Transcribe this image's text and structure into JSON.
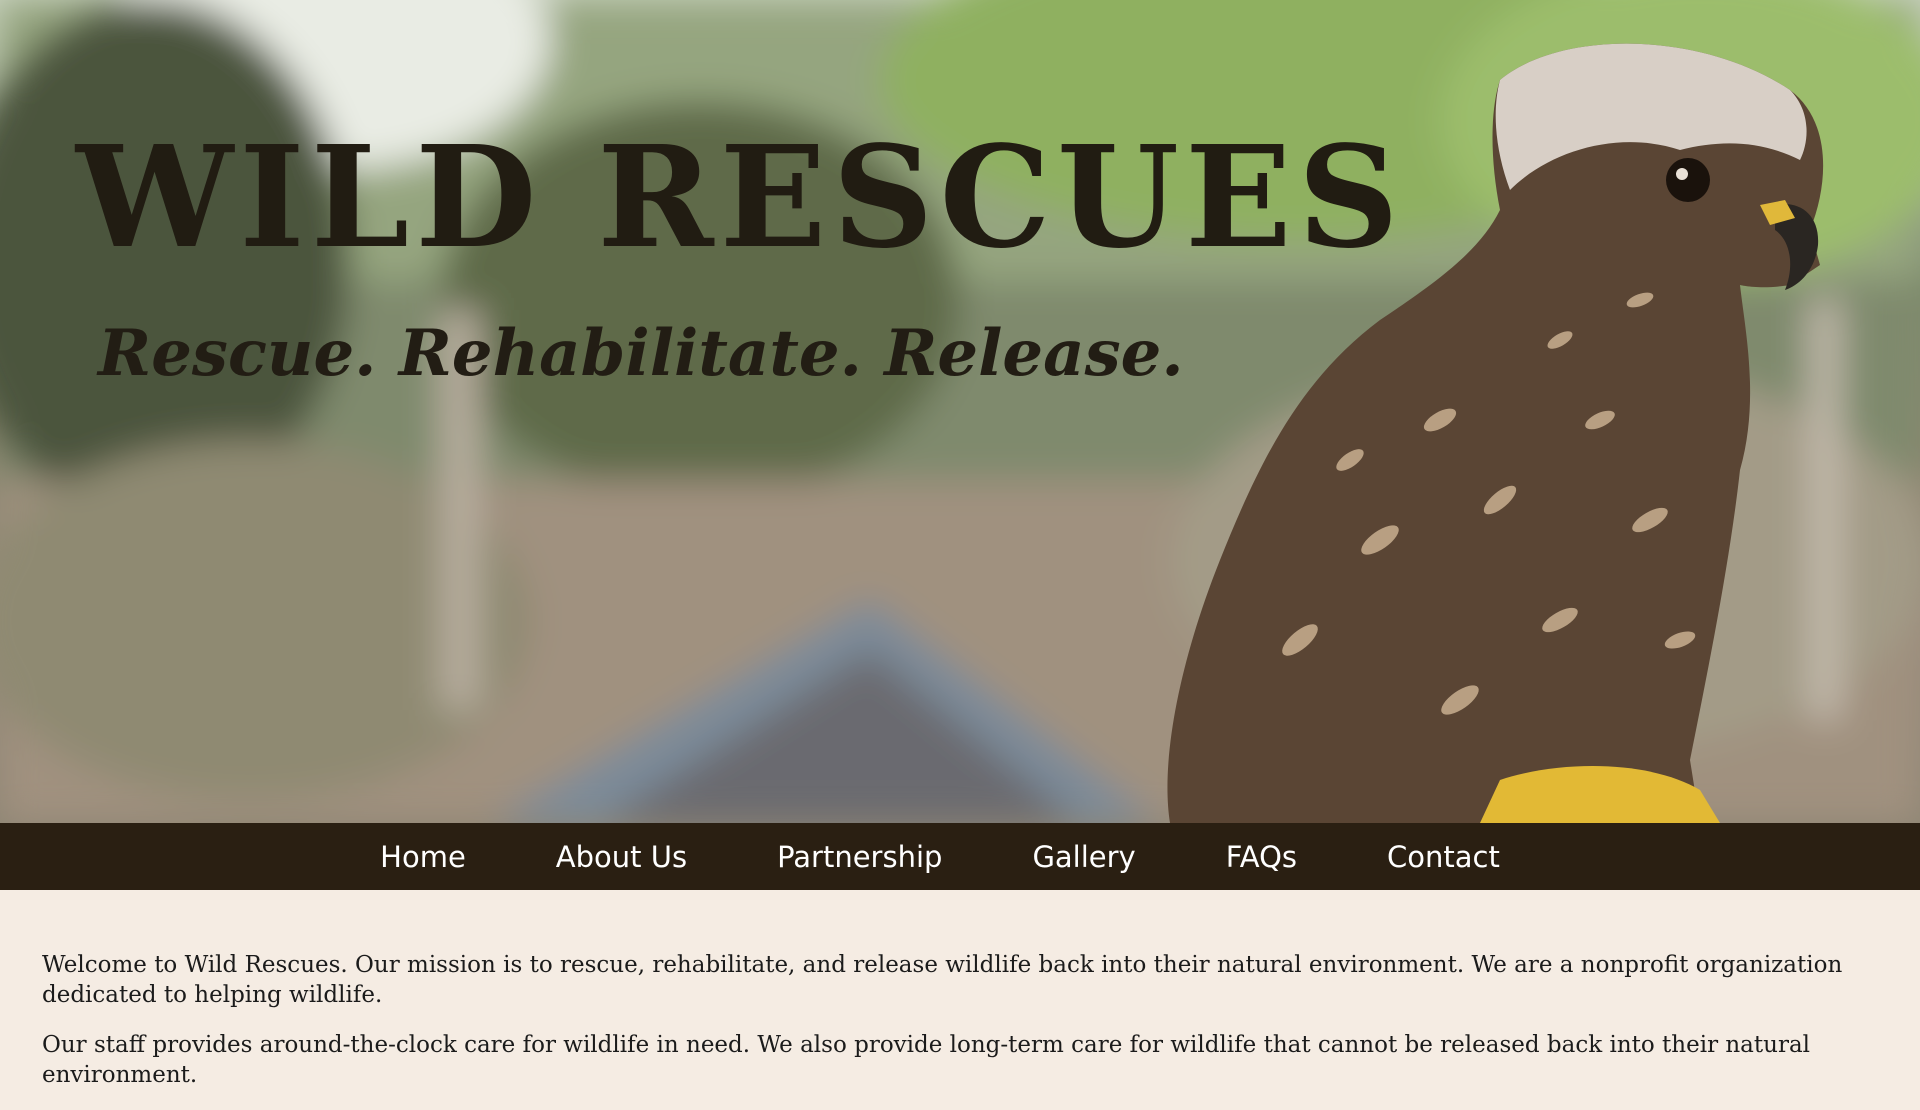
{
  "hero": {
    "title": "WILD RESCUES",
    "tagline": "Rescue. Rehabilitate. Release."
  },
  "nav": {
    "items": [
      {
        "label": "Home"
      },
      {
        "label": "About Us"
      },
      {
        "label": "Partnership"
      },
      {
        "label": "Gallery"
      },
      {
        "label": "FAQs"
      },
      {
        "label": "Contact"
      }
    ]
  },
  "content": {
    "paragraph1": "Welcome to Wild Rescues. Our mission is to rescue, rehabilitate, and release wildlife back into their natural environment. We are a nonprofit organization dedicated to helping wildlife.",
    "paragraph2": "Our staff provides around-the-clock care for wildlife in need. We also provide long-term care for wildlife that cannot be released back into their natural environment."
  },
  "colors": {
    "nav_background": "#2a1f12",
    "page_background": "#f5ece3",
    "title_color": "#211c12"
  }
}
